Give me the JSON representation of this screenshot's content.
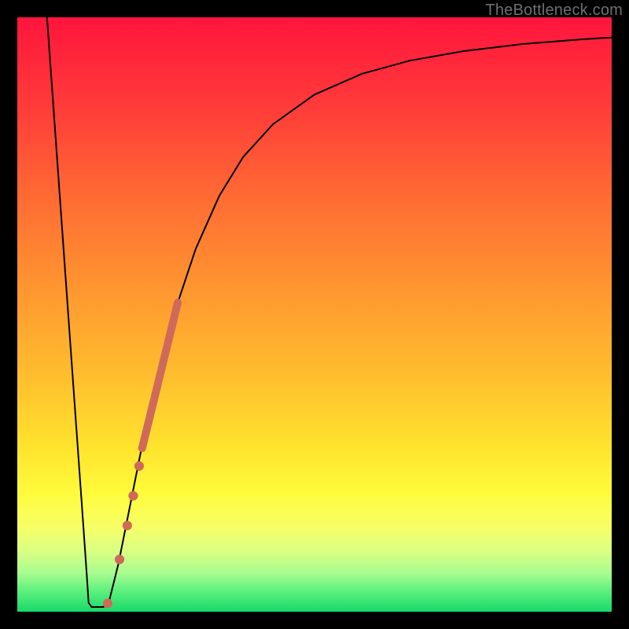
{
  "attribution": "TheBottleneck.com",
  "colors": {
    "gradient_stops": [
      {
        "y": 0.0,
        "c": "#ff153c"
      },
      {
        "y": 0.15,
        "c": "#ff3b39"
      },
      {
        "y": 0.3,
        "c": "#ff6a33"
      },
      {
        "y": 0.45,
        "c": "#ff9430"
      },
      {
        "y": 0.6,
        "c": "#ffbd2e"
      },
      {
        "y": 0.72,
        "c": "#ffe22d"
      },
      {
        "y": 0.8,
        "c": "#fffb3b"
      },
      {
        "y": 0.86,
        "c": "#f6ff68"
      },
      {
        "y": 0.9,
        "c": "#d8ff84"
      },
      {
        "y": 0.935,
        "c": "#a8fc8f"
      },
      {
        "y": 0.965,
        "c": "#5ef07e"
      },
      {
        "y": 1.0,
        "c": "#17d96a"
      }
    ],
    "curve": "#000000",
    "markers": "#cf6a5a",
    "frame": "#000000",
    "attribution_text": "#6f6f6f"
  },
  "chart_data": {
    "type": "line",
    "x_range": [
      0,
      100
    ],
    "y_range": [
      0,
      100
    ],
    "curve": [
      {
        "x": 5.0,
        "y": 100.0
      },
      {
        "x": 6.0,
        "y": 86.0
      },
      {
        "x": 7.0,
        "y": 72.0
      },
      {
        "x": 8.0,
        "y": 58.0
      },
      {
        "x": 9.0,
        "y": 44.0
      },
      {
        "x": 10.0,
        "y": 30.0
      },
      {
        "x": 11.0,
        "y": 16.0
      },
      {
        "x": 11.7,
        "y": 6.0
      },
      {
        "x": 12.0,
        "y": 1.5
      },
      {
        "x": 12.5,
        "y": 0.8
      },
      {
        "x": 14.5,
        "y": 0.8
      },
      {
        "x": 15.5,
        "y": 2.0
      },
      {
        "x": 17.0,
        "y": 8.0
      },
      {
        "x": 19.0,
        "y": 18.0
      },
      {
        "x": 21.0,
        "y": 28.0
      },
      {
        "x": 24.0,
        "y": 41.0
      },
      {
        "x": 27.0,
        "y": 52.0
      },
      {
        "x": 30.0,
        "y": 61.0
      },
      {
        "x": 34.0,
        "y": 70.0
      },
      {
        "x": 38.0,
        "y": 76.5
      },
      {
        "x": 43.0,
        "y": 82.0
      },
      {
        "x": 50.0,
        "y": 87.0
      },
      {
        "x": 58.0,
        "y": 90.5
      },
      {
        "x": 66.0,
        "y": 92.7
      },
      {
        "x": 75.0,
        "y": 94.3
      },
      {
        "x": 85.0,
        "y": 95.5
      },
      {
        "x": 95.0,
        "y": 96.3
      },
      {
        "x": 100.0,
        "y": 96.6
      }
    ],
    "dot_markers": [
      {
        "x": 15.2,
        "y": 1.4
      },
      {
        "x": 17.2,
        "y": 8.8
      },
      {
        "x": 18.5,
        "y": 14.5
      },
      {
        "x": 19.5,
        "y": 19.5
      },
      {
        "x": 20.5,
        "y": 24.5
      }
    ],
    "thick_segment": {
      "x0": 21.0,
      "y0": 27.5,
      "x1": 27.0,
      "y1": 52.0
    }
  }
}
